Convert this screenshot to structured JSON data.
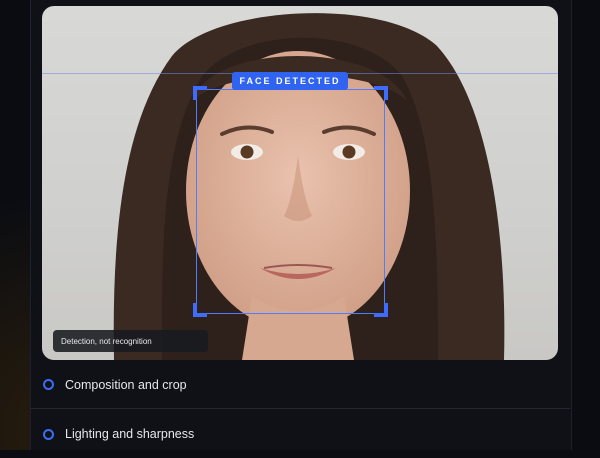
{
  "viewer": {
    "badge_text": "FACE DETECTED",
    "caption_text": "Detection, not recognition",
    "accent_color": "#2f63f0"
  },
  "checklist": {
    "items": [
      {
        "label": "Composition and crop",
        "icon": "circle-ring-icon"
      },
      {
        "label": "Lighting and sharpness",
        "icon": "circle-ring-icon"
      }
    ]
  }
}
